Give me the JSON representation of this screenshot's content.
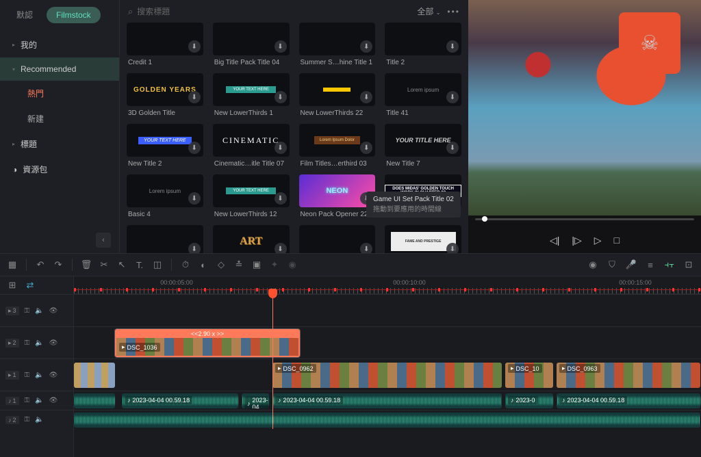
{
  "tabs": {
    "default": "默認",
    "filmstock": "Filmstock"
  },
  "search": {
    "placeholder": "搜索標題"
  },
  "header": {
    "all": "全部"
  },
  "sidebar": {
    "my": "我的",
    "recommended": "Recommended",
    "hot": "熱門",
    "new": "新建",
    "titles": "標題",
    "pack": "資源包"
  },
  "cards": [
    {
      "label": "Credit 1",
      "style": "plain",
      "text": ""
    },
    {
      "label": "Big Title Pack Title 04",
      "style": "plain",
      "text": ""
    },
    {
      "label": "Summer S…hine Title 1",
      "style": "plain",
      "text": ""
    },
    {
      "label": "Title 2",
      "style": "plain",
      "text": ""
    },
    {
      "label": "3D Golden Title",
      "style": "golden",
      "text": "GOLDEN YEARS"
    },
    {
      "label": "New LowerThirds 1",
      "style": "teal",
      "text": "YOUR TEXT HERE"
    },
    {
      "label": "New LowerThirds 22",
      "style": "yellowbar",
      "text": ""
    },
    {
      "label": "Title 41",
      "style": "plain",
      "text": "Lorem ipsum"
    },
    {
      "label": "New Title 2",
      "style": "lower",
      "text": "YOUR TEXT HERE"
    },
    {
      "label": "Cinematic…itle Title 07",
      "style": "cinematic",
      "text": "CINEMATIC"
    },
    {
      "label": "Film Titles…erthird 03",
      "style": "filmbrown",
      "text": "Lorem Ipsum Dolor"
    },
    {
      "label": "New Title 7",
      "style": "italic",
      "text": "YOUR TITLE HERE"
    },
    {
      "label": "Basic 4",
      "style": "plain",
      "text": "Lorem ipsum"
    },
    {
      "label": "New LowerThirds 12",
      "style": "teal",
      "text": "YOUR TEXT HERE"
    },
    {
      "label": "Neon Pack Opener 22",
      "style": "neon",
      "text": "NEON"
    },
    {
      "label": "Game U…",
      "style": "comic",
      "text": "DOES MIDAS' GOLDEN TOUCH WORK IN CHAPTER 3?"
    },
    {
      "label": "",
      "style": "plain",
      "text": ""
    },
    {
      "label": "",
      "style": "art",
      "text": "ART"
    },
    {
      "label": "",
      "style": "plain",
      "text": ""
    },
    {
      "label": "",
      "style": "fame",
      "text": "FAME AND PRESTIGE"
    }
  ],
  "tooltip": {
    "title": "Game UI Set Pack Title 02",
    "hint": "拖動到要應用的時間線"
  },
  "ruler": {
    "t1": "00:00:05:00",
    "t2": "00:00:10:00",
    "t3": "00:00:15:00"
  },
  "tracks": {
    "v3": "3",
    "v2": "2",
    "v1": "1",
    "a1": "1",
    "a2": "2",
    "clip_selected": {
      "name": "DSC_1036",
      "speed": "<<2.90 x >>"
    },
    "clip2": "DSC_0962",
    "clip3": "DSC_10",
    "clip4": "DSC_0963",
    "audio1": "2023-04-04 00.59.18",
    "audio2": "2023-04",
    "audio3": "2023-04-04 00.59.18",
    "audio4": "2023-0",
    "audio5": "2023-04-04 00.59.18"
  }
}
